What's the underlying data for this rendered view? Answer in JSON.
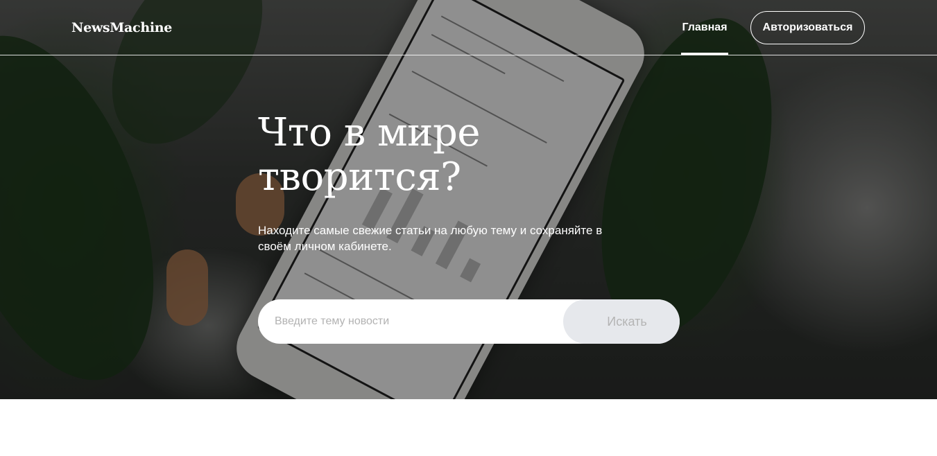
{
  "header": {
    "logo": "NewsMachine",
    "nav_home": "Главная",
    "login_button": "Авторизоваться"
  },
  "hero": {
    "title": "Что в мире творится?",
    "subtitle": "Находите самые свежие статьи на любую тему и сохраняйте в своём личном кабинете."
  },
  "search": {
    "placeholder": "Введите тему новости",
    "button_label": "Искать"
  },
  "colors": {
    "accent_text": "#ffffff",
    "search_button_bg": "#e6e8ec",
    "search_button_text": "#b4b4b4"
  }
}
